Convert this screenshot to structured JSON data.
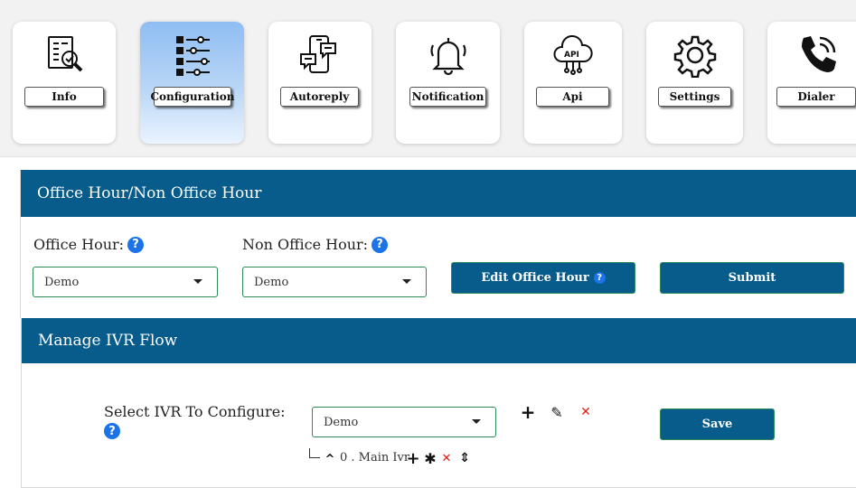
{
  "tabs": [
    {
      "label": "Info",
      "icon": "document-search-icon",
      "active": false
    },
    {
      "label": "Configuration",
      "icon": "sliders-list-icon",
      "active": true
    },
    {
      "label": "Autoreply",
      "icon": "phone-chat-icon",
      "active": false
    },
    {
      "label": "Notification",
      "icon": "bell-icon",
      "active": false
    },
    {
      "label": "Api",
      "icon": "api-cloud-icon",
      "active": false
    },
    {
      "label": "Settings",
      "icon": "gear-icon",
      "active": false
    },
    {
      "label": "Dialer",
      "icon": "phone-call-icon",
      "active": false
    }
  ],
  "office": {
    "heading": "Office Hour/Non Office Hour",
    "office_hour_label": "Office Hour:",
    "office_hour_value": "Demo",
    "non_office_hour_label": "Non Office Hour:",
    "non_office_hour_value": "Demo",
    "edit_button": "Edit Office Hour",
    "submit_button": "Submit",
    "help_glyph": "?"
  },
  "ivr": {
    "heading": "Manage IVR Flow",
    "select_label": "Select IVR To Configure:",
    "select_value": "Demo",
    "save_button": "Save",
    "add_glyph": "+",
    "edit_glyph": "✎",
    "delete_glyph": "✕",
    "tree": {
      "expand_glyph": "^",
      "node_label": "0 . Main Ivr",
      "add_glyph": "+",
      "star_glyph": "✱",
      "delete_glyph": "✕",
      "sort_glyph": "⇕"
    }
  },
  "colors": {
    "header_blue": "#075c8b",
    "help_blue": "#1a73e8",
    "delete_red": "#e0201b",
    "border_green": "#2e8b57"
  }
}
